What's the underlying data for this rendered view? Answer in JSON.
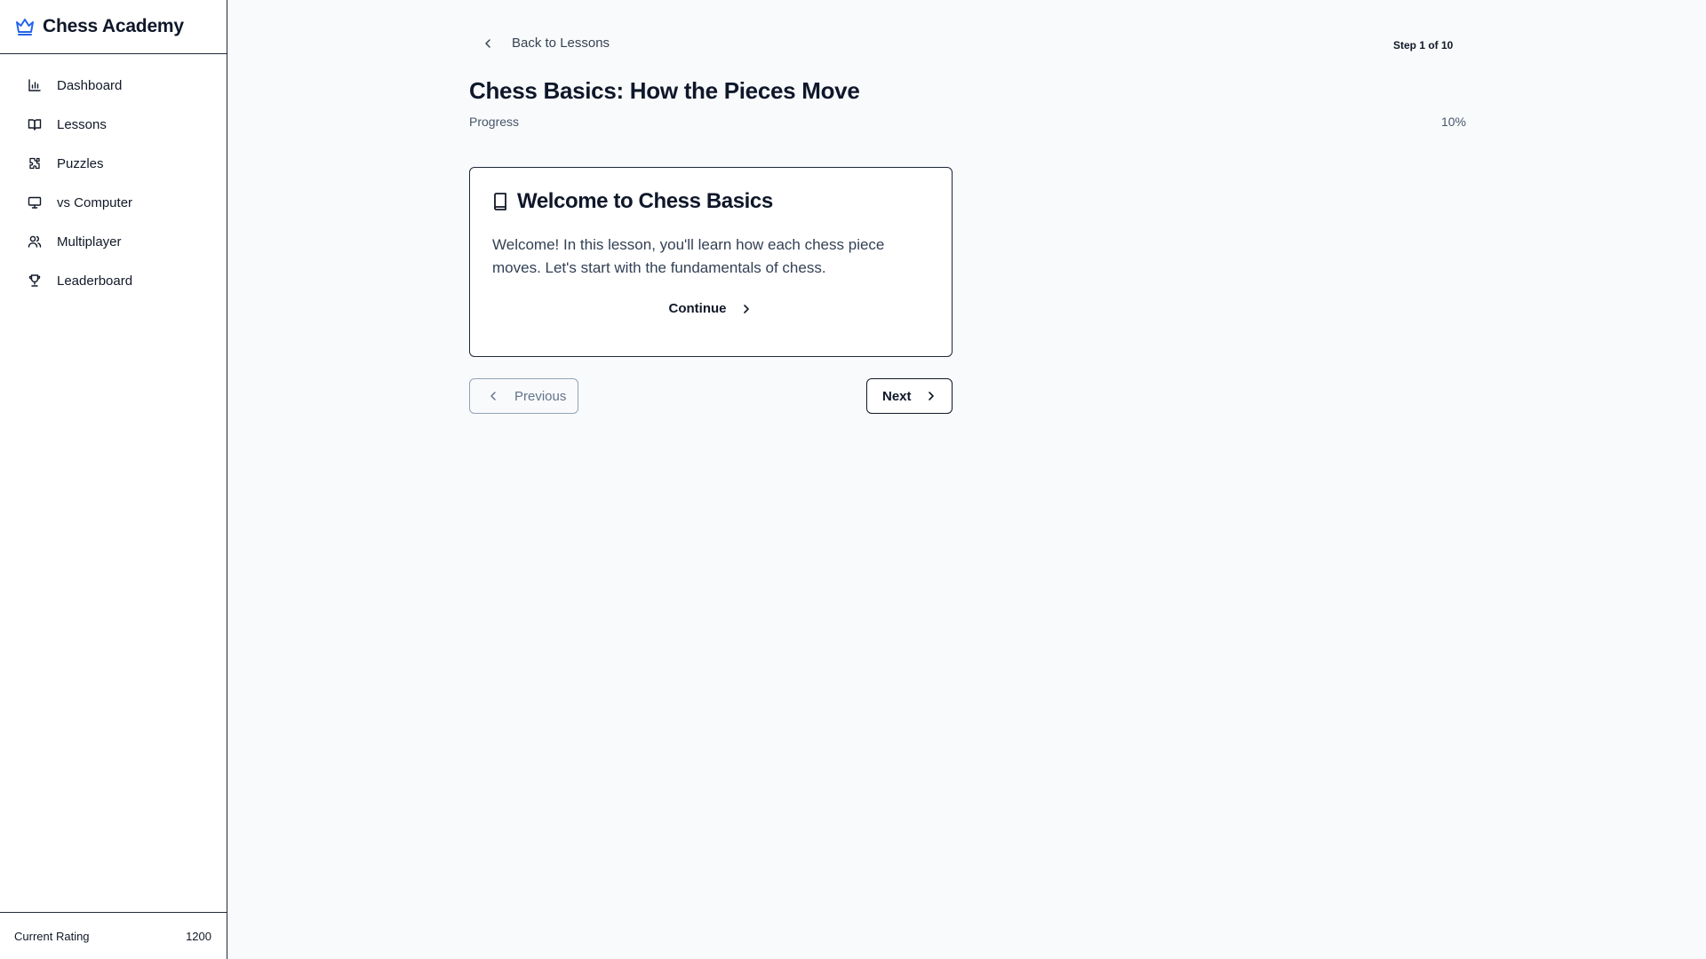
{
  "app": {
    "title": "Chess Academy",
    "accent_color": "#2563eb"
  },
  "sidebar": {
    "items": [
      {
        "label": "Dashboard",
        "icon": "bar-chart-icon"
      },
      {
        "label": "Lessons",
        "icon": "book-open-icon"
      },
      {
        "label": "Puzzles",
        "icon": "puzzle-icon"
      },
      {
        "label": "vs Computer",
        "icon": "monitor-icon"
      },
      {
        "label": "Multiplayer",
        "icon": "users-icon"
      },
      {
        "label": "Leaderboard",
        "icon": "trophy-icon"
      }
    ],
    "footer": {
      "rating_label": "Current Rating",
      "rating_value": "1200"
    }
  },
  "lesson": {
    "back_label": "Back to Lessons",
    "step_text": "Step 1 of 10",
    "title": "Chess Basics: How the Pieces Move",
    "progress_label": "Progress",
    "progress_text": "10%",
    "progress_fraction": 0.1,
    "card": {
      "title": "Welcome to Chess Basics",
      "icon": "book-icon",
      "body": "Welcome! In this lesson, you'll learn how each chess piece moves. Let's start with the fundamentals of chess.",
      "continue_label": "Continue"
    },
    "nav": {
      "previous_label": "Previous",
      "next_label": "Next"
    }
  }
}
